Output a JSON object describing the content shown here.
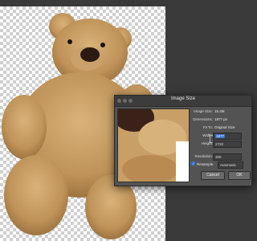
{
  "dialog": {
    "title": "Image Size",
    "image_size": {
      "label": "Image Size:",
      "value": "15.4M"
    },
    "dimensions": {
      "label": "Dimensions:",
      "value": "1877 px"
    },
    "fit_to": {
      "label": "Fit To:",
      "value": "Original Size"
    },
    "width": {
      "label": "Width:",
      "value": "1877"
    },
    "height": {
      "label": "Height:",
      "value": "2720"
    },
    "resolution": {
      "label": "Resolution:",
      "value": "300"
    },
    "resample": {
      "label": "Resample:",
      "value": "Automatic",
      "checked": true
    },
    "cancel_label": "Cancel",
    "ok_label": "OK"
  },
  "colors": {
    "accent": "#2f6fd1",
    "dialog_bg": "#535353",
    "workspace": "#3a3a3a"
  },
  "icons": [
    "traffic-light-close-icon",
    "traffic-light-minimize-icon",
    "traffic-light-zoom-icon",
    "link-chain-icon",
    "checkbox-checked-icon"
  ]
}
